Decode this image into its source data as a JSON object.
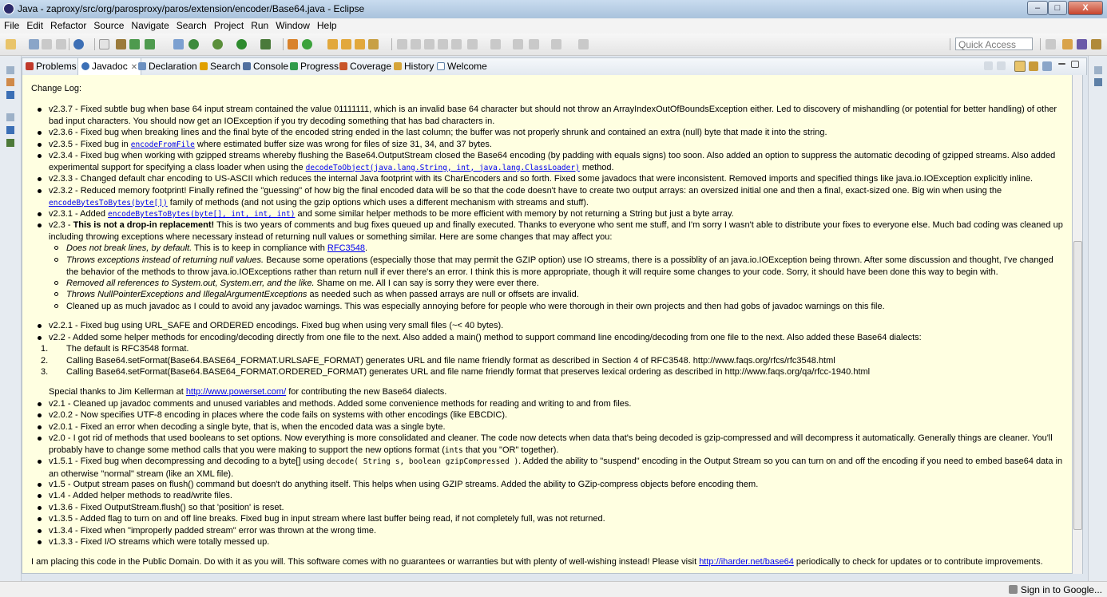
{
  "window": {
    "title": "Java - zaproxy/src/org/parosproxy/paros/extension/encoder/Base64.java - Eclipse",
    "minimize": "–",
    "maximize": "□",
    "close": "X"
  },
  "menu": [
    "File",
    "Edit",
    "Refactor",
    "Source",
    "Navigate",
    "Search",
    "Project",
    "Run",
    "Window",
    "Help"
  ],
  "quick_access": {
    "placeholder": "Quick Access"
  },
  "tabs": [
    {
      "label": "Problems",
      "icon": "problems-icon",
      "color": "#c0392b"
    },
    {
      "label": "Javadoc",
      "icon": "javadoc-icon",
      "color": "#3b6fb6"
    },
    {
      "label": "Declaration",
      "icon": "declaration-icon",
      "color": "#6a8fc0"
    },
    {
      "label": "Search",
      "icon": "search-icon",
      "color": "#e0a000"
    },
    {
      "label": "Console",
      "icon": "console-icon",
      "color": "#4f6f9f"
    },
    {
      "label": "Progress",
      "icon": "progress-icon",
      "color": "#2f9b4b"
    },
    {
      "label": "Coverage",
      "icon": "coverage-icon",
      "color": "#c8552a"
    },
    {
      "label": "History",
      "icon": "history-icon",
      "color": "#d6a53a"
    },
    {
      "label": "Welcome",
      "icon": "welcome-icon",
      "color": "#5d7fa6"
    }
  ],
  "doc": {
    "heading": "Change Log:",
    "b01": {
      "pre": "v2.3.7 - Fixed subtle bug when base 64 input stream contained the value 01111111, which is an invalid base 64 character but should not throw an ArrayIndexOutOfBoundsException either. Led to discovery of mishandling (or potential for better handling) of other bad input characters. You should now get an IOException if you try decoding something that has bad characters in."
    },
    "b02": {
      "pre": "v2.3.6 - Fixed bug when breaking lines and the final byte of the encoded string ended in the last column; the buffer was not properly shrunk and contained an extra (null) byte that made it into the string."
    },
    "b03": {
      "pre": "v2.3.5 - Fixed bug in ",
      "link": "encodeFromFile",
      "post": " where estimated buffer size was wrong for files of size 31, 34, and 37 bytes."
    },
    "b04": {
      "pre": "v2.3.4 - Fixed bug when working with gzipped streams whereby flushing the Base64.OutputStream closed the Base64 encoding (by padding with equals signs) too soon. Also added an option to suppress the automatic decoding of gzipped streams. Also added experimental support for specifying a class loader when using the ",
      "link": "decodeToObject(java.lang.String, int, java.lang.ClassLoader)",
      "post": " method."
    },
    "b05": {
      "pre": "v2.3.3 - Changed default char encoding to US-ASCII which reduces the internal Java footprint with its CharEncoders and so forth. Fixed some javadocs that were inconsistent. Removed imports and specified things like java.io.IOException explicitly inline."
    },
    "b06": {
      "pre": "v2.3.2 - Reduced memory footprint! Finally refined the \"guessing\" of how big the final encoded data will be so that the code doesn't have to create two output arrays: an oversized initial one and then a final, exact-sized one. Big win when using the ",
      "link": "encodeBytesToBytes(byte[])",
      "post": " family of methods (and not using the gzip options which uses a different mechanism with streams and stuff)."
    },
    "b07": {
      "pre": "v2.3.1 - Added ",
      "link": "encodeBytesToBytes(byte[], int, int, int)",
      "post": " and some similar helper methods to be more efficient with memory by not returning a String but just a byte array."
    },
    "b08": {
      "pre": "v2.3 - ",
      "bold": "This is not a drop-in replacement!",
      "post": " This is two years of comments and bug fixes queued up and finally executed. Thanks to everyone who sent me stuff, and I'm sorry I wasn't able to distribute your fixes to everyone else. Much bad coding was cleaned up including throwing exceptions where necessary instead of returning null values or something similar. Here are some changes that may affect you:"
    },
    "s1": {
      "em": "Does not break lines, by default.",
      "pre": " This is to keep in compliance with ",
      "link": "RFC3548",
      "post": "."
    },
    "s2": {
      "em": "Throws exceptions instead of returning null values.",
      "post": " Because some operations (especially those that may permit the GZIP option) use IO streams, there is a possiblity of an java.io.IOException being thrown. After some discussion and thought, I've changed the behavior of the methods to throw java.io.IOExceptions rather than return null if ever there's an error. I think this is more appropriate, though it will require some changes to your code. Sorry, it should have been done this way to begin with."
    },
    "s3": {
      "em": "Removed all references to System.out, System.err, and the like.",
      "post": " Shame on me. All I can say is sorry they were ever there."
    },
    "s4": {
      "em": "Throws NullPointerExceptions and IllegalArgumentExceptions",
      "post": " as needed such as when passed arrays are null or offsets are invalid."
    },
    "s5": {
      "post": "Cleaned up as much javadoc as I could to avoid any javadoc warnings. This was especially annoying before for people who were thorough in their own projects and then had gobs of javadoc warnings on this file."
    },
    "b09": {
      "pre": "v2.2.1 - Fixed bug using URL_SAFE and ORDERED encodings. Fixed bug when using very small files (~< 40 bytes)."
    },
    "b10": {
      "pre": "v2.2 - Added some helper methods for encoding/decoding directly from one file to the next. Also added a main() method to support command line encoding/decoding from one file to the next. Also added these Base64 dialects:"
    },
    "n1": {
      "num": "1.",
      "text": "The default is RFC3548 format."
    },
    "n2": {
      "num": "2.",
      "text": "Calling Base64.setFormat(Base64.BASE64_FORMAT.URLSAFE_FORMAT) generates URL and file name friendly format as described in Section 4 of RFC3548. http://www.faqs.org/rfcs/rfc3548.html"
    },
    "n3": {
      "num": "3.",
      "text": "Calling Base64.setFormat(Base64.BASE64_FORMAT.ORDERED_FORMAT) generates URL and file name friendly format that preserves lexical ordering as described in http://www.faqs.org/qa/rfcc-1940.html"
    },
    "thanks": {
      "pre": "Special thanks to Jim Kellerman at ",
      "link": "http://www.powerset.com/",
      "post": " for contributing the new Base64 dialects."
    },
    "b11": {
      "pre": "v2.1 - Cleaned up javadoc comments and unused variables and methods. Added some convenience methods for reading and writing to and from files."
    },
    "b12": {
      "pre": "v2.0.2 - Now specifies UTF-8 encoding in places where the code fails on systems with other encodings (like EBCDIC)."
    },
    "b13": {
      "pre": "v2.0.1 - Fixed an error when decoding a single byte, that is, when the encoded data was a single byte."
    },
    "b14": {
      "pre": "v2.0 - I got rid of methods that used booleans to set options. Now everything is more consolidated and cleaner. The code now detects when data that's being decoded is gzip-compressed and will decompress it automatically. Generally things are cleaner. You'll probably have to change some method calls that you were making to support the new options format (",
      "code": "ints",
      "post": " that you \"OR\" together)."
    },
    "b15": {
      "pre": "v1.5.1 - Fixed bug when decompressing and decoding to a byte[] using ",
      "code": "decode( String s, boolean gzipCompressed )",
      "post": ". Added the ability to \"suspend\" encoding in the Output Stream so you can turn on and off the encoding if you need to embed base64 data in an otherwise \"normal\" stream (like an XML file)."
    },
    "b16": {
      "pre": "v1.5 - Output stream pases on flush() command but doesn't do anything itself. This helps when using GZIP streams. Added the ability to GZip-compress objects before encoding them."
    },
    "b17": {
      "pre": "v1.4 - Added helper methods to read/write files."
    },
    "b18": {
      "pre": "v1.3.6 - Fixed OutputStream.flush() so that 'position' is reset."
    },
    "b19": {
      "pre": "v1.3.5 - Added flag to turn on and off line breaks. Fixed bug in input stream where last buffer being read, if not completely full, was not returned."
    },
    "b20": {
      "pre": "v1.3.4 - Fixed when \"improperly padded stream\" error was thrown at the wrong time."
    },
    "b21": {
      "pre": "v1.3.3 - Fixed I/O streams which were totally messed up."
    },
    "footer": {
      "pre": "I am placing this code in the Public Domain. Do with it as you will. This software comes with no guarantees or warranties but with plenty of well-wishing instead! Please visit ",
      "link": "http://iharder.net/base64",
      "post": " periodically to check for updates or to contribute improvements."
    }
  },
  "status": {
    "signin": "Sign in to Google..."
  }
}
